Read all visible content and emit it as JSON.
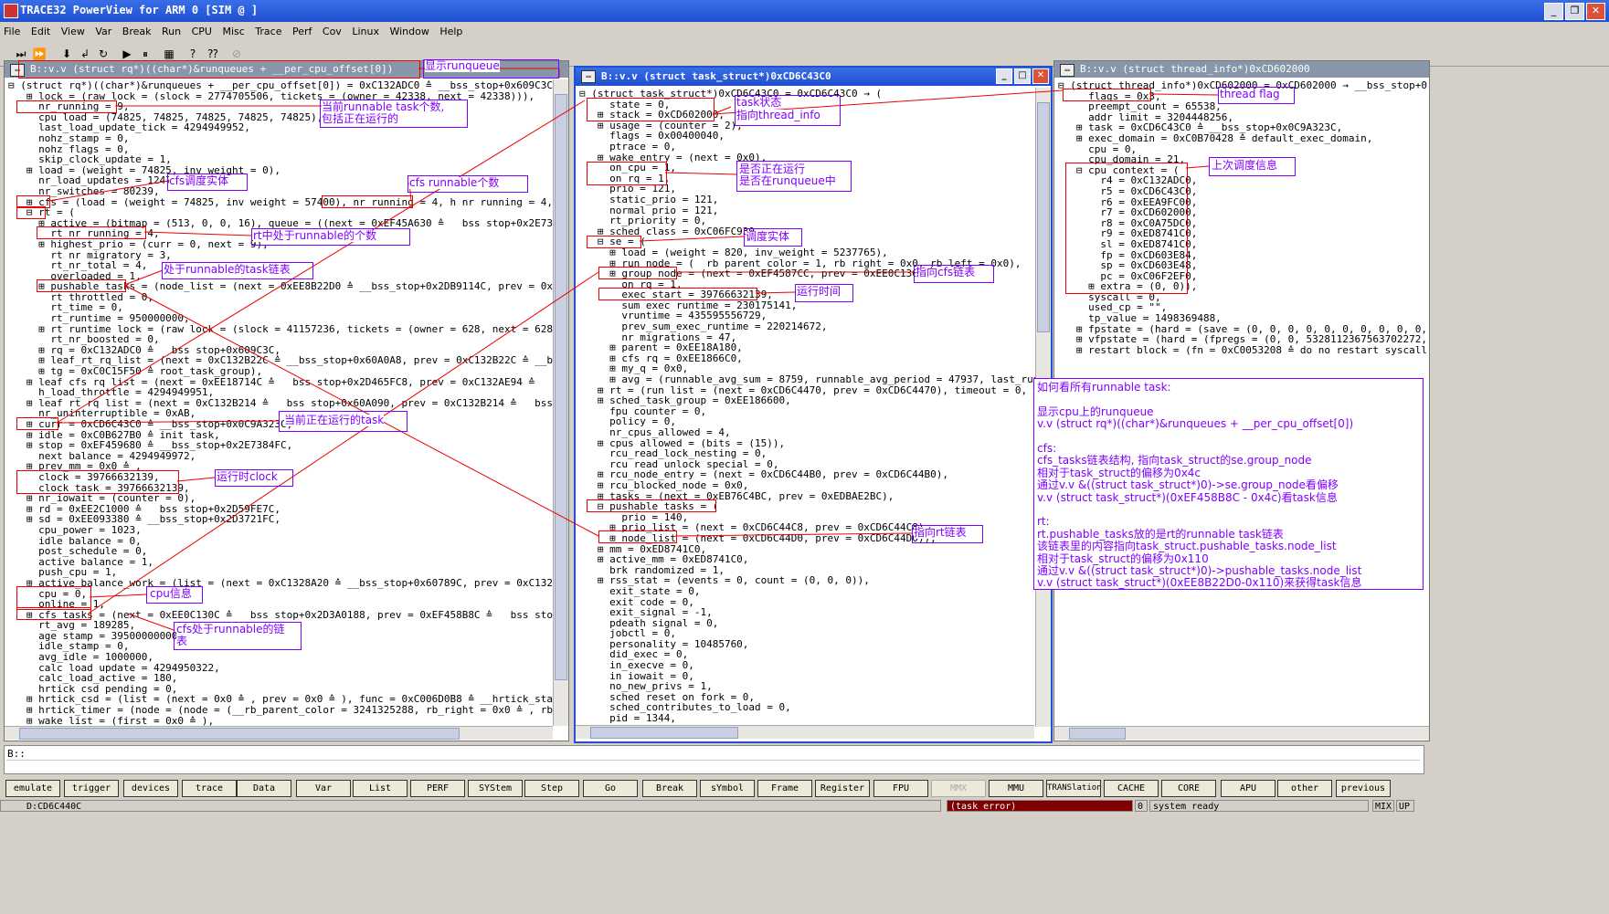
{
  "app": {
    "title": "TRACE32 PowerView for ARM 0 [SIM @ ]"
  },
  "menu": [
    "File",
    "Edit",
    "View",
    "Var",
    "Break",
    "Run",
    "CPU",
    "Misc",
    "Trace",
    "Perf",
    "Cov",
    "Linux",
    "Window",
    "Help"
  ],
  "toolbar_icons": [
    "step-into-icon",
    "step-over-icon",
    "step-down-icon",
    "step-return-icon",
    "undo-step-icon",
    "go-icon",
    "break-icon",
    "mode-icon",
    "help-icon",
    "context-help-icon",
    "stop-icon"
  ],
  "panels": {
    "left": {
      "title": "B::v.v (struct rq*)((char*)&runqueues + __per_cpu_offset[0])",
      "lines": [
        "⊟ (struct rq*)((char*)&runqueues + __per_cpu_offset[0]) = 0xC132ADC0 ≙ __bss_stop+0x609C3C → (",
        "   ⊞ lock = (raw_lock = (slock = 2774705506, tickets = (owner = 42338, next = 42338))),",
        "     nr_running = 9,",
        "     cpu_load = (74825, 74825, 74825, 74825, 74825),",
        "     last_load_update_tick = 4294949952,",
        "     nohz_stamp = 0,",
        "     nohz_flags = 0,",
        "     skip_clock_update = 1,",
        "   ⊞ load = (weight = 74825, inv_weight = 0),",
        "     nr_load_updates = 12475,",
        "     nr_switches = 80239,",
        "   ⊞ cfs = (load = (weight = 74825, inv_weight = 57400), nr_running = 4, h_nr_running = 4, exec_c",
        "   ⊟ rt = (",
        "     ⊞ active = (bitmap = (513, 0, 0, 16), queue = ((next = 0xEF45A630 ≙ __bss_stop+0x2E7394AC, p",
        "       rt_nr_running = 4,",
        "     ⊞ highest_prio = (curr = 0, next = 9),",
        "       rt_nr_migratory = 3,",
        "       rt_nr_total = 4,",
        "       overloaded = 1,",
        "     ⊞ pushable_tasks = (node_list = (next = 0xEE8B22D0 ≙ __bss_stop+0x2DB9114C, prev = 0xEEF4DF1",
        "       rt_throttled = 0,",
        "       rt_time = 0,",
        "       rt_runtime = 950000000,",
        "     ⊞ rt_runtime_lock = (raw_lock = (slock = 41157236, tickets = (owner = 628, next = 628))),",
        "       rt_nr_boosted = 0,",
        "     ⊞ rq = 0xC132ADC0 ≙ __bss_stop+0x609C3C,",
        "     ⊞ leaf_rt_rq_list = (next = 0xC132B22C ≙ __bss_stop+0x60A0A8, prev = 0xC132B22C ≙ __bss_stop",
        "     ⊞ tg = 0xC0C15F50 ≙ root_task_group),",
        "   ⊞ leaf_cfs_rq_list = (next = 0xEE18714C ≙ __bss_stop+0x2D465FC8, prev = 0xC132AE94 ≙ __bss_sto",
        "     h_load_throttle = 4294949951,",
        "   ⊞ leaf_rt_rq_list = (next = 0xC132B214 ≙ __bss_stop+0x60A090, prev = 0xC132B214 ≙ __bss_stop+0",
        "     nr_uninterruptible = 0xAB,",
        "   ⊞ curr = 0xCD6C43C0 ≙ __bss_stop+0x0C9A323C,",
        "   ⊞ idle = 0xC0B627B0 ≙ init_task,",
        "   ⊞ stop = 0xEF459680 ≙ __bss_stop+0x2E7384FC,",
        "     next_balance = 4294949972,",
        "   ⊞ prev_mm = 0x0 ≙ ,",
        "     clock = 39766632139,",
        "     clock_task = 39766632139,",
        "   ⊞ nr_iowait = (counter = 0),",
        "   ⊞ rd = 0xEE2C1000 ≙ __bss_stop+0x2D59FE7C,",
        "   ⊞ sd = 0xEE093380 ≙ __bss_stop+0x2D3721FC,",
        "     cpu_power = 1023,",
        "     idle_balance = 0,",
        "     post_schedule = 0,",
        "     active_balance = 1,",
        "     push_cpu = 1,",
        "   ⊞ active_balance_work = (list = (next = 0xC1328A20 ≙ __bss_stop+0x60789C, prev = 0xC1328A20 ≙",
        "     cpu = 0,",
        "     online = 1,",
        "   ⊞ cfs_tasks = (next = 0xEE0C130C ≙ __bss_stop+0x2D3A0188, prev = 0xEF458B8C ≙ __bss_stop+0x2E7",
        "     rt_avg = 189285,",
        "     age_stamp = 39500000000,",
        "     idle_stamp = 0,",
        "     avg_idle = 1000000,",
        "     calc_load_update = 4294950322,",
        "     calc_load_active = 180,",
        "     hrtick_csd_pending = 0,",
        "   ⊞ hrtick_csd = (list = (next = 0x0 ≙ , prev = 0x0 ≙ ), func = 0xC006D0B8 ≙ __hrtick_start, inf",
        "   ⊞ hrtick_timer = (node = (node = (__rb_parent_color = 3241325288, rb_right = 0x0 ≙ , rb_left =",
        "   ⊞ wake_list = (first = 0x0 ≙ ),"
      ]
    },
    "middle": {
      "title": "B::v.v (struct task_struct*)0xCD6C43C0",
      "lines": [
        "⊟ (struct task_struct*)0xCD6C43C0 = 0xCD6C43C0 → (",
        "     state = 0,",
        "   ⊞ stack = 0xCD602000,",
        "   ⊞ usage = (counter = 2),",
        "     flags = 0x00400040,",
        "     ptrace = 0,",
        "   ⊞ wake_entry = (next = 0x0),",
        "     on_cpu = 1,",
        "     on_rq = 1,",
        "     prio = 121,",
        "     static_prio = 121,",
        "     normal_prio = 121,",
        "     rt_priority = 0,",
        "   ⊞ sched_class = 0xC06FC930,",
        "   ⊟ se = (",
        "     ⊞ load = (weight = 820, inv_weight = 5237765),",
        "     ⊞ run_node = (__rb_parent_color = 1, rb_right = 0x0, rb_left = 0x0),",
        "     ⊞ group_node = (next = 0xEF4587CC, prev = 0xEE0C130C),",
        "       on_rq = 1,",
        "       exec_start = 39766632139,",
        "       sum_exec_runtime = 230175141,",
        "       vruntime = 435595556729,",
        "       prev_sum_exec_runtime = 220214672,",
        "       nr_migrations = 47,",
        "     ⊞ parent = 0xEE18A180,",
        "     ⊞ cfs_rq = 0xEE1866C0,",
        "     ⊞ my_q = 0x0,",
        "     ⊞ avg = (runnable_avg_sum = 8759, runnable_avg_period = 47937, last_runnable",
        "   ⊞ rt = (run_list = (next = 0xCD6C4470, prev = 0xCD6C4470), timeout = 0, watchd",
        "   ⊞ sched_task_group = 0xEE186600,",
        "     fpu_counter = 0,",
        "     policy = 0,",
        "     nr_cpus_allowed = 4,",
        "   ⊞ cpus_allowed = (bits = (15)),",
        "     rcu_read_lock_nesting = 0,",
        "     rcu_read_unlock_special = 0,",
        "   ⊞ rcu_node_entry = (next = 0xCD6C44B0, prev = 0xCD6C44B0),",
        "   ⊞ rcu_blocked_node = 0x0,",
        "   ⊞ tasks = (next = 0xEB76C4BC, prev = 0xEDBAE2BC),",
        "   ⊟ pushable_tasks = (",
        "       prio = 140,",
        "     ⊞ prio_list = (next = 0xCD6C44C8, prev = 0xCD6C44C8),",
        "     ⊞ node_list = (next = 0xCD6C44D0, prev = 0xCD6C44D0)),",
        "   ⊞ mm = 0xED8741C0,",
        "   ⊞ active_mm = 0xED8741C0,",
        "     brk_randomized = 1,",
        "   ⊞ rss_stat = (events = 0, count = (0, 0, 0)),",
        "     exit_state = 0,",
        "     exit_code = 0,",
        "     exit_signal = -1,",
        "     pdeath_signal = 0,",
        "     jobctl = 0,",
        "     personality = 10485760,",
        "     did_exec = 0,",
        "     in_execve = 0,",
        "     in_iowait = 0,",
        "     no_new_privs = 1,",
        "     sched_reset_on_fork = 0,",
        "     sched_contributes_to_load = 0,",
        "     pid = 1344,"
      ]
    },
    "right": {
      "title": "B::v.v (struct thread_info*)0xCD602000",
      "lines": [
        "⊟ (struct thread_info*)0xCD602000 = 0xCD602000 → __bss_stop+0xC8E",
        "     flags = 0x3,",
        "     preempt_count = 65538,",
        "     addr_limit = 3204448256,",
        "   ⊞ task = 0xCD6C43C0 ≙ __bss_stop+0x0C9A323C,",
        "   ⊞ exec_domain = 0xC0B70428 ≙ default_exec_domain,",
        "     cpu = 0,",
        "     cpu_domain = 21,",
        "   ⊟ cpu_context = (",
        "       r4 = 0xC132ADC0,",
        "       r5 = 0xCD6C43C0,",
        "       r6 = 0xEEA9FC00,",
        "       r7 = 0xCD602000,",
        "       r8 = 0xC0A75DC0,",
        "       r9 = 0xED8741C0,",
        "       sl = 0xED8741C0,",
        "       fp = 0xCD603E84,",
        "       sp = 0xCD603E48,",
        "       pc = 0xC06F2EF0,",
        "     ⊞ extra = (0, 0)),",
        "     syscall = 0,",
        "     used_cp = \"\",",
        "     tp_value = 1498369488,",
        "   ⊞ fpstate = (hard = (save = (0, 0, 0, 0, 0, 0, 0, 0, 0, 0, 0, 0,",
        "   ⊞ vfpstate = (hard = (fpregs = (0, 0, 5328112367563702272, 84552",
        "   ⊞ restart_block = (fn = 0xC0053208 ≙ do_no_restart_syscall, fute"
      ]
    }
  },
  "annotations": {
    "show_runqueue": "显示runqueue",
    "current_runnable": "当前runnable task个数,\n包括正在运行的",
    "cfs_entity": "cfs调度实体",
    "cfs_runnable_count": "cfs runnable个数",
    "rt_runnable_count": "rt中处于runnable的个数",
    "runnable_task_list": "处于runnable的task链表",
    "current_running_task": "当前正在运行的task",
    "run_clock": "运行时clock",
    "cpu_info": "cpu信息",
    "cfs_runnable_list": "cfs处于runnable的链\n表",
    "task_state": "task状态",
    "point_thread_info": "指向thread_info",
    "is_running": "是否正在运行\n是否在runqueue中",
    "sched_entity": "调度实体",
    "point_cfs_list": "指向cfs链表",
    "run_time": "运行时间",
    "point_rt_list": "指向rt链表",
    "thread_flag": "thread flag",
    "last_sched_info": "上次调度信息"
  },
  "note": {
    "lines": [
      "如何看所有runnable task:",
      "",
      "显示cpu上的runqueue",
      "v.v (struct rq*)((char*)&runqueues + __per_cpu_offset[0])",
      "",
      "cfs:",
      "cfs_tasks链表结构, 指向task_struct的se.group_node",
      "相对于task_struct的偏移为0x4c",
      "通过v.v &((struct task_struct*)0)->se.group_node看偏移",
      "v.v (struct task_struct*)(0xEF458B8C - 0x4c)看task信息",
      "",
      "rt:",
      "rt.pushable_tasks放的是rt的runnable task链表",
      "该链表里的内容指向task_struct.pushable_tasks.node_list",
      "相对于task_struct的偏移为0x110",
      "通过v.v &((struct task_struct*)0)->pushable_tasks.node_list",
      "v.v (struct task_struct*)(0xEE8B22D0-0x110)来获得task信息"
    ]
  },
  "command": {
    "prompt": "B::"
  },
  "softkeys": [
    "emulate",
    "trigger",
    "devices",
    "trace",
    "Data",
    "Var",
    "List",
    "PERF",
    "SYStem",
    "Step",
    "Go",
    "Break",
    "sYmbol",
    "Frame",
    "Register",
    "FPU",
    "MMX",
    "MMU",
    "TRANSlation",
    "CACHE",
    "CORE",
    "APU",
    "other",
    "previous"
  ],
  "status": {
    "address": "D:CD6C440C",
    "error": "(task error)",
    "count": "0",
    "state": "system ready",
    "mode1": "MIX",
    "mode2": "UP"
  }
}
